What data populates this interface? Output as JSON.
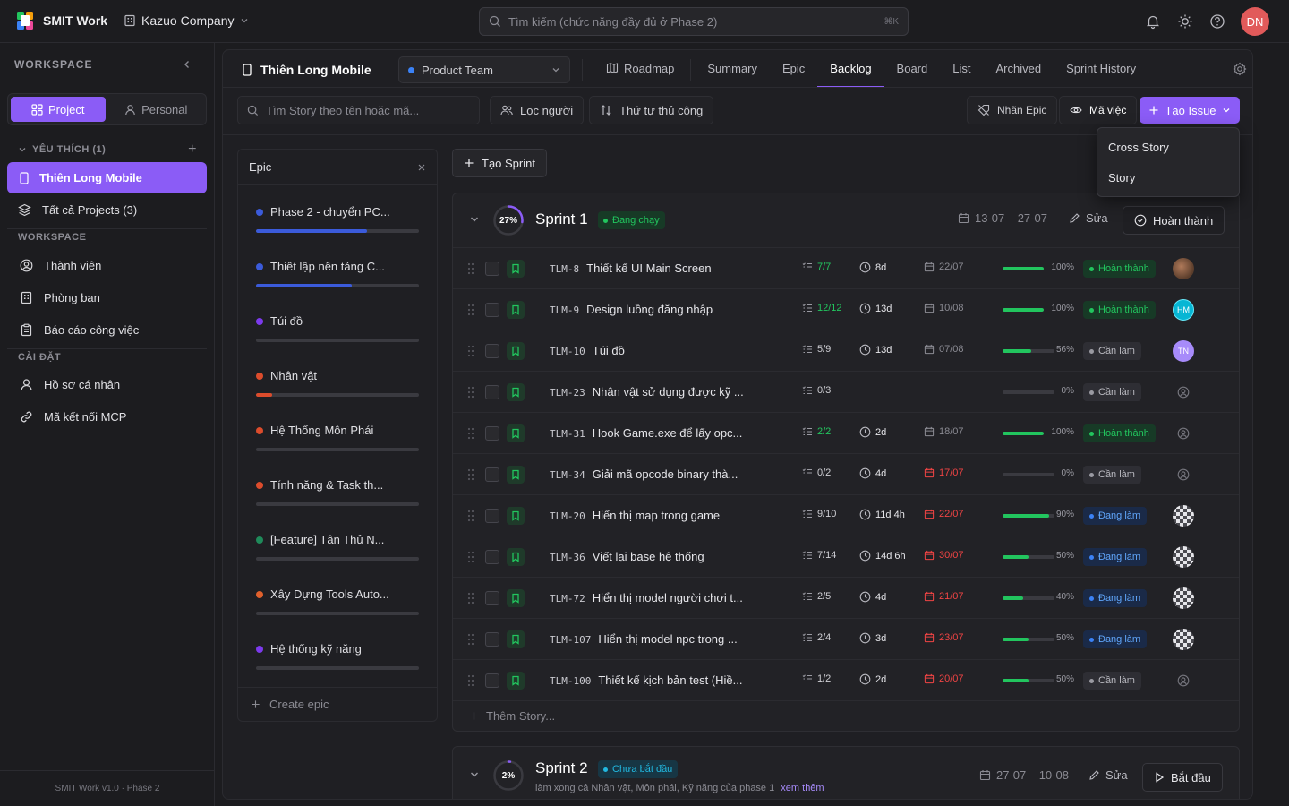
{
  "app": {
    "name": "SMIT Work",
    "company": "Kazuo Company",
    "user_initials": "DN"
  },
  "search": {
    "placeholder": "Tìm kiếm (chức năng đầy đủ ở Phase 2)",
    "shortcut": "⌘K"
  },
  "sidebar": {
    "workspace_title": "WORKSPACE",
    "seg_project": "Project",
    "seg_personal": "Personal",
    "favorites_label": "YÊU THÍCH (1)",
    "favorite_project": "Thiên Long Mobile",
    "all_projects": "Tất cả Projects (3)",
    "workspace_section": "WORKSPACE",
    "workspace_items": [
      "Thành viên",
      "Phòng ban",
      "Báo cáo công việc"
    ],
    "settings_section": "CÀI ĐẶT",
    "settings_items": [
      "Hồ sơ cá nhân",
      "Mã kết nối MCP"
    ],
    "version": "SMIT Work v1.0 · Phase 2"
  },
  "project": {
    "name": "Thiên Long Mobile",
    "team": "Product Team"
  },
  "tabs": [
    "Roadmap",
    "Summary",
    "Epic",
    "Backlog",
    "Board",
    "List",
    "Archived",
    "Sprint History"
  ],
  "active_tab": "Backlog",
  "toolbar": {
    "search_placeholder": "Tìm Story theo tên hoặc mã...",
    "filter_people": "Lọc người",
    "manual_order": "Thứ tự thủ công",
    "epic_label": "Nhãn Epic",
    "issue_code": "Mã việc",
    "create_issue": "Tạo Issue"
  },
  "dropdown": [
    "Cross Story",
    "Story"
  ],
  "epic_panel": {
    "title": "Epic",
    "create_label": "Create epic",
    "items": [
      {
        "name": "Phase 2 - chuyển PC...",
        "color": "#3b5bdb",
        "progress": 0.68
      },
      {
        "name": "Thiết lập nền tảng C...",
        "color": "#3b5bdb",
        "progress": 0.59
      },
      {
        "name": "Túi đồ",
        "color": "#7c3aed",
        "progress": 0
      },
      {
        "name": "Nhân vật",
        "color": "#dc4c2c",
        "progress": 0.1
      },
      {
        "name": "Hệ Thống Môn Phái",
        "color": "#dc4c2c",
        "progress": 0
      },
      {
        "name": "Tính năng & Task th...",
        "color": "#dc4c2c",
        "progress": 0
      },
      {
        "name": "[Feature] Tân Thủ N...",
        "color": "#1f8a5a",
        "progress": 0
      },
      {
        "name": "Xây Dựng Tools Auto...",
        "color": "#e0602c",
        "progress": 0
      },
      {
        "name": "Hệ thống kỹ năng",
        "color": "#7c3aed",
        "progress": 0
      }
    ]
  },
  "create_sprint": "Tạo Sprint",
  "sprints": [
    {
      "name": "Sprint 1",
      "progress_label": "27%",
      "progress": 0.27,
      "status": "Đang chạy",
      "dates": "13-07 – 27-07",
      "edit": "Sửa",
      "action": "Hoàn thành",
      "add_story": "Thêm Story...",
      "stories": [
        {
          "key": "TLM-8",
          "title": "Thiết kế UI Main Screen",
          "subtasks": "7/7",
          "sub_done": true,
          "estimate": "8d",
          "due": "22/07",
          "due_late": false,
          "progress": 100,
          "pct": "100%",
          "status": "Hoàn thành",
          "status_type": "done",
          "assignee": "photo",
          "assignee_initials": ""
        },
        {
          "key": "TLM-9",
          "title": "Design luồng đăng nhập",
          "subtasks": "12/12",
          "sub_done": true,
          "estimate": "13d",
          "due": "10/08",
          "due_late": false,
          "progress": 100,
          "pct": "100%",
          "status": "Hoàn thành",
          "status_type": "done",
          "assignee": "initials-cyan",
          "assignee_initials": "HM"
        },
        {
          "key": "TLM-10",
          "title": "Túi đồ",
          "subtasks": "5/9",
          "sub_done": false,
          "estimate": "13d",
          "due": "07/08",
          "due_late": false,
          "progress": 56,
          "pct": "56%",
          "status": "Cần làm",
          "status_type": "todo",
          "assignee": "initials-purple",
          "assignee_initials": "TN"
        },
        {
          "key": "TLM-23",
          "title": "Nhân vật sử dụng được kỹ ...",
          "subtasks": "0/3",
          "sub_done": false,
          "estimate": "",
          "due": "",
          "due_late": false,
          "progress": 0,
          "pct": "0%",
          "status": "Cần làm",
          "status_type": "todo",
          "assignee": "none",
          "assignee_initials": ""
        },
        {
          "key": "TLM-31",
          "title": "Hook Game.exe để lấy opc...",
          "subtasks": "2/2",
          "sub_done": true,
          "estimate": "2d",
          "due": "18/07",
          "due_late": false,
          "progress": 100,
          "pct": "100%",
          "status": "Hoàn thành",
          "status_type": "done",
          "assignee": "none",
          "assignee_initials": ""
        },
        {
          "key": "TLM-34",
          "title": "Giải mã opcode binary thà...",
          "subtasks": "0/2",
          "sub_done": false,
          "estimate": "4d",
          "due": "17/07",
          "due_late": true,
          "progress": 0,
          "pct": "0%",
          "status": "Cần làm",
          "status_type": "todo",
          "assignee": "none",
          "assignee_initials": ""
        },
        {
          "key": "TLM-20",
          "title": "Hiển thị map trong game",
          "subtasks": "9/10",
          "sub_done": false,
          "estimate": "11d 4h",
          "due": "22/07",
          "due_late": true,
          "progress": 90,
          "pct": "90%",
          "status": "Đang làm",
          "status_type": "progress",
          "assignee": "pattern",
          "assignee_initials": ""
        },
        {
          "key": "TLM-36",
          "title": "Viết lại base hệ thống",
          "subtasks": "7/14",
          "sub_done": false,
          "estimate": "14d 6h",
          "due": "30/07",
          "due_late": true,
          "progress": 50,
          "pct": "50%",
          "status": "Đang làm",
          "status_type": "progress",
          "assignee": "pattern",
          "assignee_initials": ""
        },
        {
          "key": "TLM-72",
          "title": "Hiển thị model người chơi t...",
          "subtasks": "2/5",
          "sub_done": false,
          "estimate": "4d",
          "due": "21/07",
          "due_late": true,
          "progress": 40,
          "pct": "40%",
          "status": "Đang làm",
          "status_type": "progress",
          "assignee": "pattern",
          "assignee_initials": ""
        },
        {
          "key": "TLM-107",
          "title": "Hiển thị model npc trong ...",
          "subtasks": "2/4",
          "sub_done": false,
          "estimate": "3d",
          "due": "23/07",
          "due_late": true,
          "progress": 50,
          "pct": "50%",
          "status": "Đang làm",
          "status_type": "progress",
          "assignee": "pattern",
          "assignee_initials": ""
        },
        {
          "key": "TLM-100",
          "title": "Thiết kế kịch bản test (Hiề...",
          "subtasks": "1/2",
          "sub_done": false,
          "estimate": "2d",
          "due": "20/07",
          "due_late": true,
          "progress": 50,
          "pct": "50%",
          "status": "Cần làm",
          "status_type": "todo",
          "assignee": "none",
          "assignee_initials": ""
        }
      ]
    },
    {
      "name": "Sprint 2",
      "progress_label": "2%",
      "progress": 0.02,
      "status": "Chưa bắt đầu",
      "dates": "27-07 – 10-08",
      "edit": "Sửa",
      "action": "Bắt đầu",
      "description": "làm xong cả Nhân vật, Môn phái, Kỹ năng của phase 1",
      "see_more": "xem thêm"
    }
  ],
  "colors": {
    "accent": "#8b5cf6",
    "done": "#22c55e",
    "progress": "#3b82f6",
    "late": "#ef4444",
    "avatar_top": "#e15a5a"
  }
}
